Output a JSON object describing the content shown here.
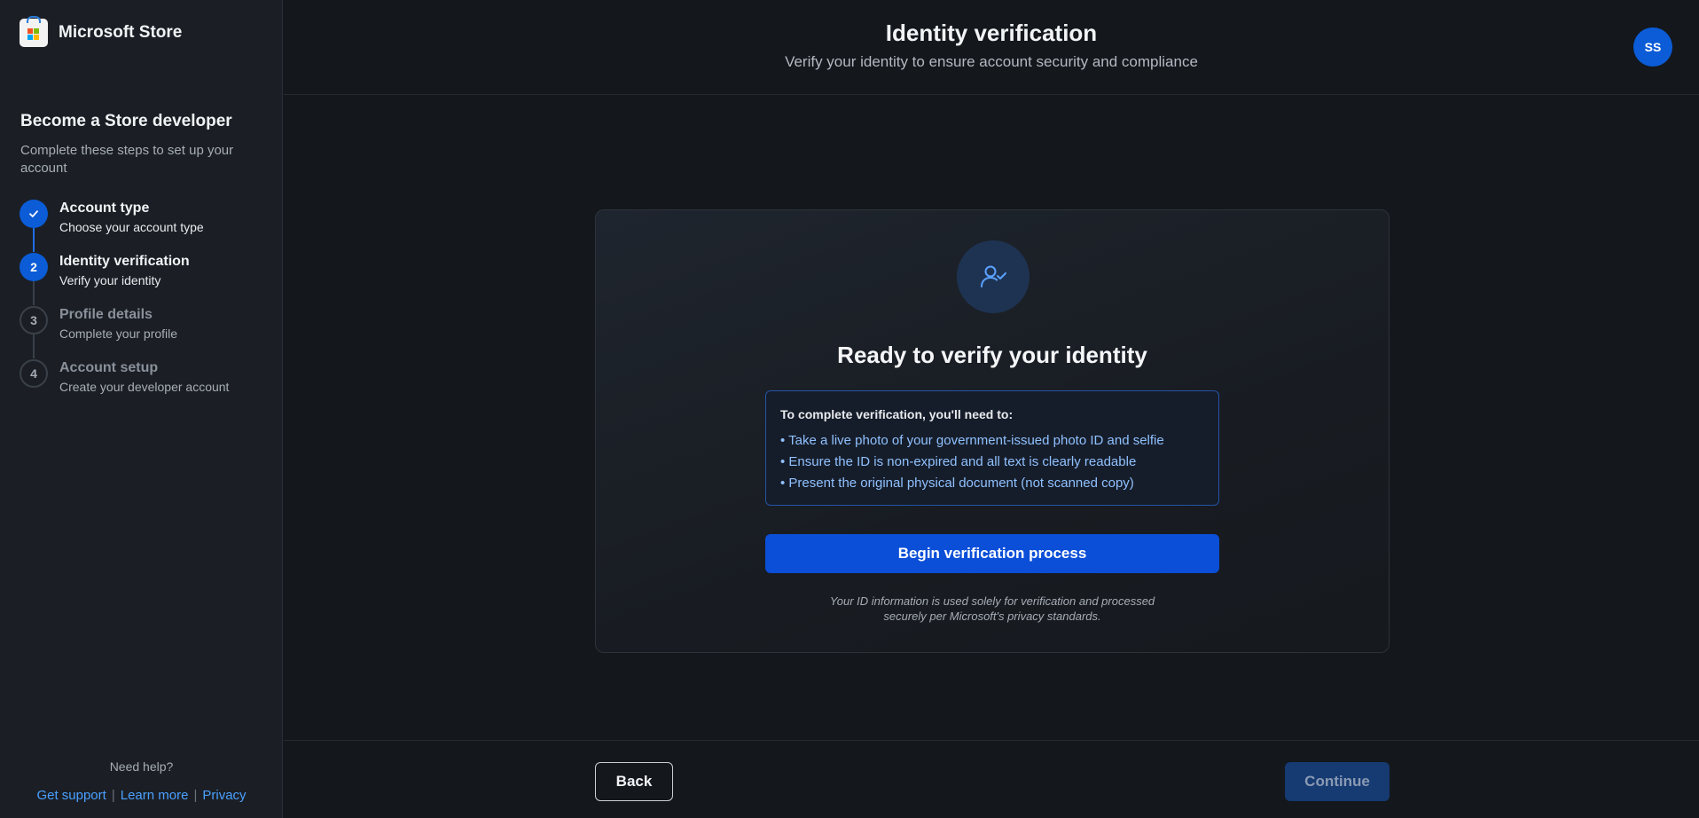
{
  "sidebar": {
    "brand": "Microsoft Store",
    "title": "Become a Store developer",
    "subtitle": "Complete these steps to set up your account",
    "steps": [
      {
        "marker": "",
        "title": "Account type",
        "description": "Choose your account type",
        "state": "done"
      },
      {
        "marker": "2",
        "title": "Identity verification",
        "description": "Verify your identity",
        "state": "active"
      },
      {
        "marker": "3",
        "title": "Profile details",
        "description": "Complete your profile",
        "state": "pending"
      },
      {
        "marker": "4",
        "title": "Account setup",
        "description": "Create your developer account",
        "state": "pending"
      }
    ],
    "help": {
      "label": "Need help?",
      "links": [
        "Get support",
        "Learn more",
        "Privacy"
      ],
      "separator": "|"
    }
  },
  "header": {
    "title": "Identity verification",
    "subtitle": "Verify your identity to ensure account security and compliance",
    "avatar_initials": "SS"
  },
  "card": {
    "icon": "user-check-icon",
    "title": "Ready to verify your identity",
    "requirements_heading": "To complete verification, you'll need to:",
    "requirements": [
      "• Take a live photo of your government-issued photo ID and selfie",
      "• Ensure the ID is non-expired and all text is clearly readable",
      "• Present the original physical document (not scanned copy)"
    ],
    "begin_label": "Begin verification process",
    "privacy_line1": "Your ID information is used solely for verification and processed",
    "privacy_line2": "securely per Microsoft's privacy standards."
  },
  "footer": {
    "back_label": "Back",
    "continue_label": "Continue"
  },
  "colors": {
    "accent": "#0b5cd6",
    "link": "#4aa0ff",
    "background": "#14171c",
    "sidebar": "#1b1f25"
  }
}
